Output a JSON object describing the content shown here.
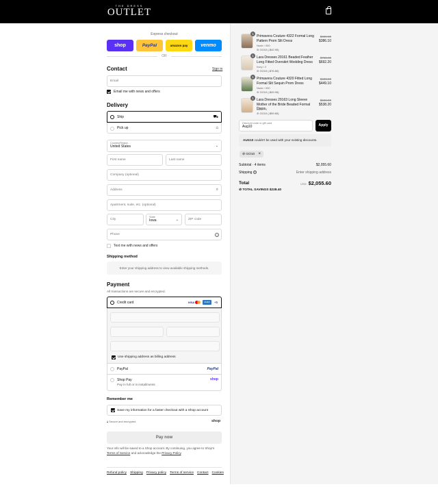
{
  "header": {
    "brand_small": "THE DRESS",
    "brand_big": "OUTLET",
    "cart_icon": "bag-icon"
  },
  "express": {
    "title": "Express checkout",
    "shop": "shop",
    "paypal": "PayPal",
    "amazon": "amazon pay",
    "venmo": "venmo",
    "or": "OR"
  },
  "contact": {
    "title": "Contact",
    "signin": "Sign in",
    "email_placeholder": "Email",
    "email_news": "Email me with news and offers",
    "email_news_checked": true
  },
  "delivery": {
    "title": "Delivery",
    "ship": "Ship",
    "pickup": "Pick up",
    "country_label": "Country/Region",
    "country_value": "United States",
    "first": "First name",
    "last": "Last name",
    "company": "Company (optional)",
    "address": "Address",
    "apartment": "Apartment, suite, etc. (optional)",
    "city": "City",
    "state_label": "State",
    "state_value": "Iowa",
    "zip": "ZIP code",
    "phone": "Phone",
    "text_news": "Text me with news and offers"
  },
  "shipping": {
    "title": "Shipping method",
    "message": "Enter your shipping address to view available shipping methods."
  },
  "payment": {
    "title": "Payment",
    "subtitle": "All transactions are secure and encrypted.",
    "credit": "Credit card",
    "more": "+5",
    "card_visa": "VISA",
    "card_amex": "AMEX",
    "billing": "Use shipping address as billing address",
    "paypal": "PayPal",
    "paypal_logo": "PayPal",
    "shoppay": "Shop Pay",
    "shoppay_sub": "Pay in full or in installments",
    "shoppay_logo": "shop"
  },
  "remember": {
    "title": "Remember me",
    "save": "Save my information for a faster checkout with a Shop account",
    "secure": "Secure and encrypted",
    "shop_logo": "shop"
  },
  "paynow": "Pay now",
  "legal": {
    "p1": "Your info will be saved to a Shop account. By continuing, you agree to Shop's",
    "tos": "Terms of Service",
    "p2": "and acknowledge the",
    "privacy": "Privacy Policy",
    "p3": "."
  },
  "footer": [
    "Refund policy",
    "Shipping",
    "Privacy policy",
    "Terms of service",
    "Contact",
    "Cookies"
  ],
  "items": [
    {
      "qty": "1",
      "name": "Primavera Couture 4322 Formal Long Pattern Prom Slit Dress",
      "variant": "Nude / 000",
      "code": "GO10 (-$42.90)",
      "old": "$429.00",
      "new": "$386.10"
    },
    {
      "qty": "1",
      "name": "Lara Dresses 29161 Beaded Feather Long Fitted Overskirt Wedding Dress",
      "variant": "Ivory / 2",
      "code": "GO10 (-$76.80)",
      "old": "$768.00",
      "new": "$692.20"
    },
    {
      "qty": "1",
      "name": "Primavera Couture 4320 Fitted Long Formal Slit Sequin Prom Dress",
      "variant": "Nude / 000",
      "code": "GO10 (-$49.90)",
      "old": "$499.00",
      "new": "$449.10"
    },
    {
      "qty": "1",
      "name": "Lara Dresses 29163 Long Sleeve Mother of the Bride Beaded Formal Dress",
      "variant": "Dove / 4",
      "code": "GO10 (-$59.80)",
      "old": "$598.00",
      "new": "$538.20"
    }
  ],
  "discount": {
    "label": "Discount code or gift card",
    "value": "Aug10",
    "apply": "Apply",
    "error_code": "AUG10",
    "error_rest": " couldn't be used with your existing discounts.",
    "tag": "GO10"
  },
  "summary": {
    "subtotal_label": "Subtotal · 4 items",
    "subtotal": "$2,055.60",
    "shipping_label": "Shipping",
    "shipping_value": "Enter shipping address",
    "total_label": "Total",
    "currency": "USD",
    "total": "$2,055.60",
    "savings_label": "TOTAL SAVINGS",
    "savings": "$228.40"
  }
}
